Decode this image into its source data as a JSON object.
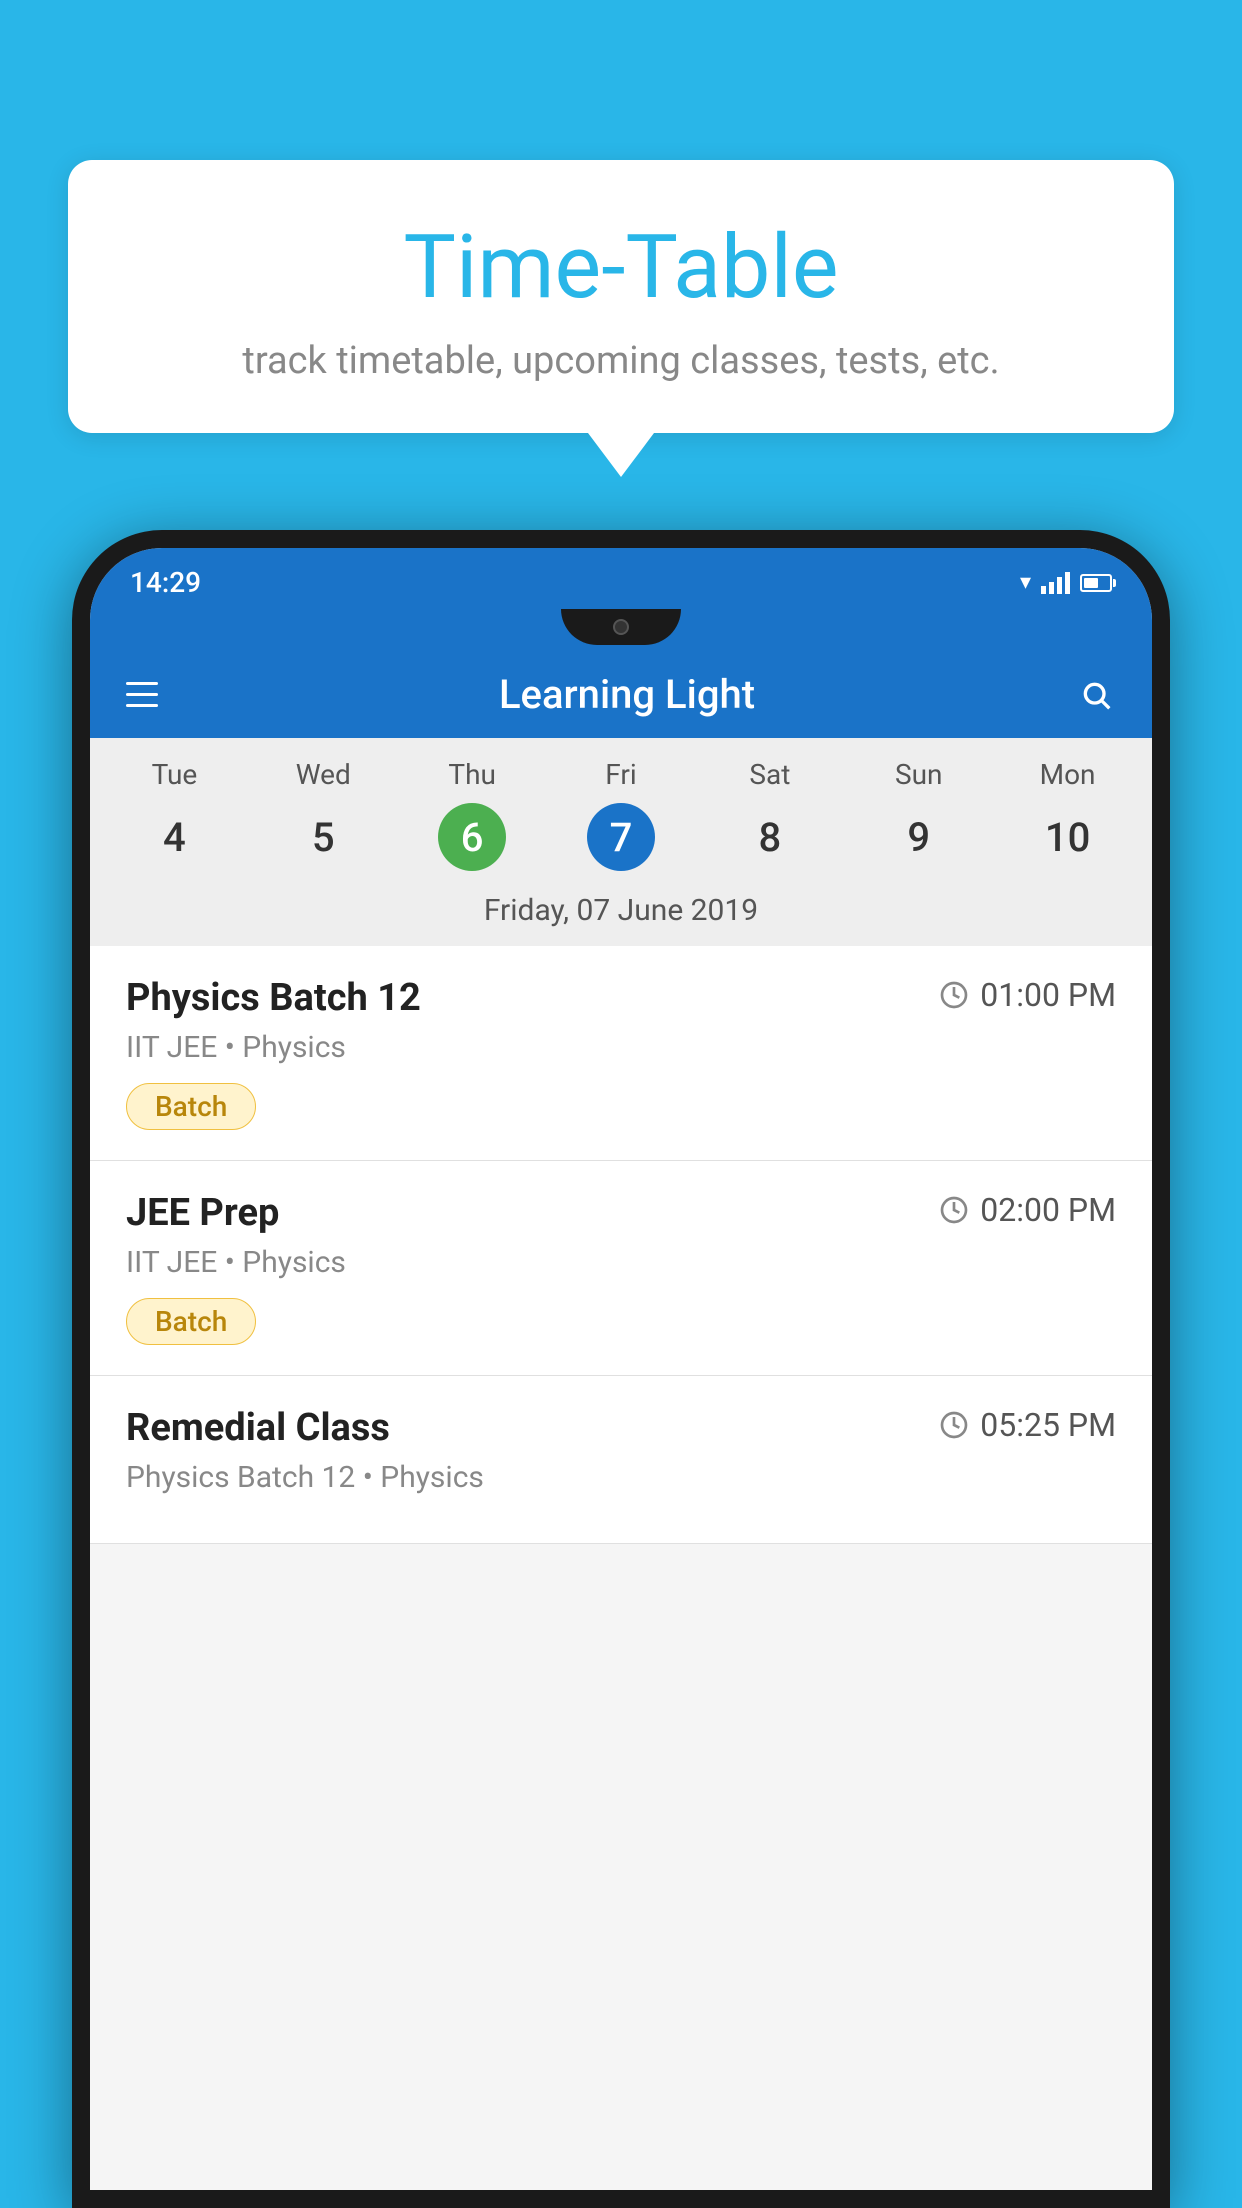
{
  "background_color": "#29b6e8",
  "tooltip": {
    "title": "Time-Table",
    "subtitle": "track timetable, upcoming classes, tests, etc."
  },
  "phone": {
    "status_bar": {
      "time": "14:29"
    },
    "app_bar": {
      "title": "Learning Light",
      "menu_icon": "hamburger-icon",
      "search_icon": "search-icon"
    },
    "calendar": {
      "days": [
        {
          "name": "Tue",
          "num": "4",
          "state": "normal"
        },
        {
          "name": "Wed",
          "num": "5",
          "state": "normal"
        },
        {
          "name": "Thu",
          "num": "6",
          "state": "today"
        },
        {
          "name": "Fri",
          "num": "7",
          "state": "selected"
        },
        {
          "name": "Sat",
          "num": "8",
          "state": "normal"
        },
        {
          "name": "Sun",
          "num": "9",
          "state": "normal"
        },
        {
          "name": "Mon",
          "num": "10",
          "state": "normal"
        }
      ],
      "selected_date_label": "Friday, 07 June 2019"
    },
    "classes": [
      {
        "name": "Physics Batch 12",
        "time": "01:00 PM",
        "meta": "IIT JEE • Physics",
        "tag": "Batch"
      },
      {
        "name": "JEE Prep",
        "time": "02:00 PM",
        "meta": "IIT JEE • Physics",
        "tag": "Batch"
      },
      {
        "name": "Remedial Class",
        "time": "05:25 PM",
        "meta": "Physics Batch 12 • Physics",
        "tag": ""
      }
    ]
  }
}
